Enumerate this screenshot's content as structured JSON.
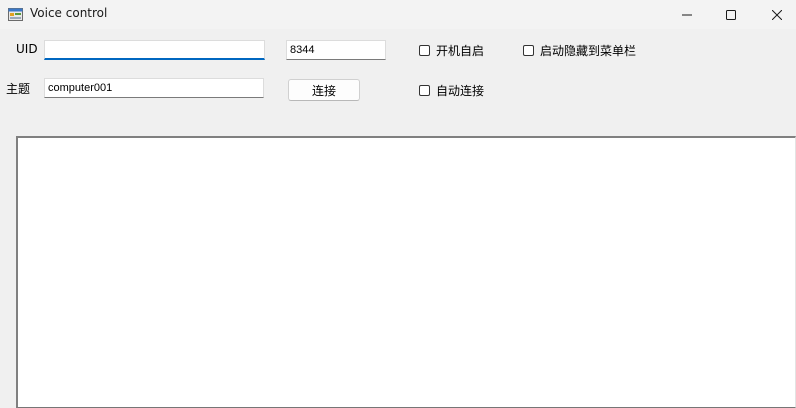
{
  "window": {
    "title": "Voice control"
  },
  "form": {
    "uid_label": "UID",
    "uid_value": "",
    "port_value": "8344",
    "topic_label": "主题",
    "topic_value": "computer001",
    "connect_label": "连接"
  },
  "options": {
    "autostart_label": "开机自启",
    "autostart_checked": false,
    "hide_to_tray_label": "启动隐藏到菜单栏",
    "hide_to_tray_checked": false,
    "autoconnect_label": "自动连接",
    "autoconnect_checked": false
  },
  "log": {
    "content": ""
  },
  "colors": {
    "accent": "#0067c0",
    "window_bg": "#f0f0f0"
  }
}
